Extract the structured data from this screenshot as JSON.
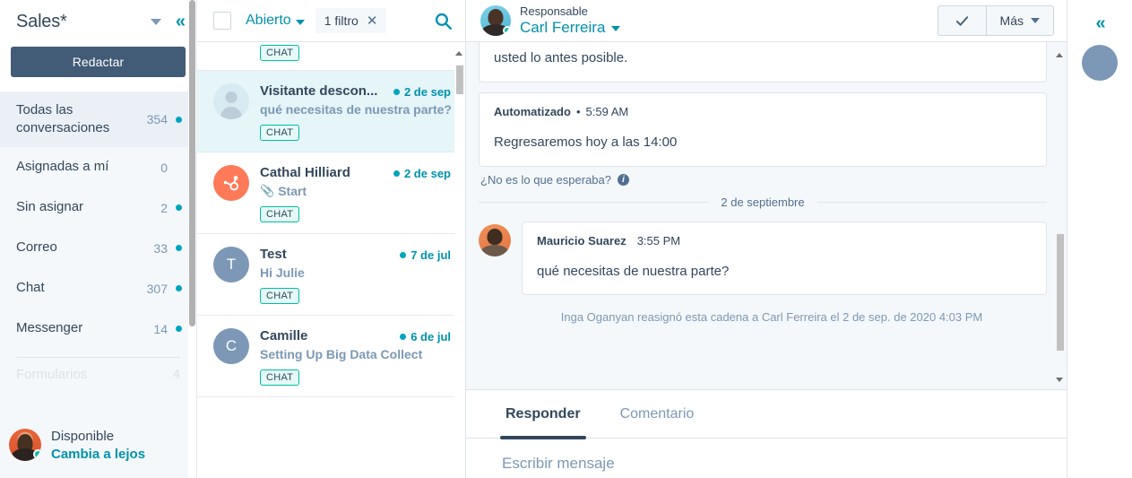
{
  "sidebar": {
    "title": "Sales*",
    "compose_label": "Redactar",
    "items": [
      {
        "label": "Todas las conversaciones",
        "count": "354",
        "dot": true
      },
      {
        "label": "Asignadas a mí",
        "count": "0",
        "dot": false
      },
      {
        "label": "Sin asignar",
        "count": "2",
        "dot": true
      },
      {
        "label": "Correo",
        "count": "33",
        "dot": true
      },
      {
        "label": "Chat",
        "count": "307",
        "dot": true
      },
      {
        "label": "Messenger",
        "count": "14",
        "dot": true
      }
    ],
    "status": {
      "state": "Disponible",
      "toggle_label": "Cambia a lejos"
    }
  },
  "conversation_list": {
    "filter_status": "Abierto",
    "filter_chip": "1 filtro",
    "filter_chip_close": "✕",
    "items": [
      {
        "name": "",
        "preview": "",
        "date": "",
        "badge": "CHAT",
        "avatar_kind": "generic",
        "initial": "",
        "selected": false,
        "partial": true
      },
      {
        "name": "Visitante descon...",
        "preview": "qué necesitas de nuestra parte?",
        "date": "2 de sep",
        "badge": "CHAT",
        "avatar_kind": "generic",
        "initial": "",
        "selected": true,
        "partial": false
      },
      {
        "name": "Cathal Hilliard",
        "preview": "Start",
        "attachment": true,
        "date": "2 de sep",
        "badge": "CHAT",
        "avatar_kind": "hubspot",
        "initial": "",
        "selected": false,
        "partial": false
      },
      {
        "name": "Test",
        "preview": "Hi Julie",
        "date": "7 de jul",
        "badge": "CHAT",
        "avatar_kind": "initial",
        "initial": "T",
        "selected": false,
        "partial": false
      },
      {
        "name": "Camille",
        "preview": "Setting Up Big Data Collect",
        "date": "6 de jul",
        "badge": "CHAT",
        "avatar_kind": "initial",
        "initial": "C",
        "selected": false,
        "partial": false
      }
    ]
  },
  "panel": {
    "assignee_role": "Responsable",
    "assignee_name": "Carl Ferreira",
    "close_button": "✓",
    "more_label": "Más",
    "messages": {
      "cut_bubble_text": "usted lo antes posible.",
      "auto_author": "Automatizado",
      "auto_separator": "•",
      "auto_time": "5:59 AM",
      "auto_text": "Regresaremos hoy a las 14:00",
      "hint": "¿No es lo que esperaba?",
      "date_divider": "2 de septiembre",
      "user_author": "Mauricio Suarez",
      "user_time": "3:55 PM",
      "user_text": "qué necesitas de nuestra parte?",
      "system_note": "Inga Oganyan reasignó esta cadena a Carl Ferreira el 2 de sep. de 2020 4:03 PM"
    },
    "composer": {
      "tab_reply": "Responder",
      "tab_comment": "Comentario",
      "placeholder": "Escribir mensaje"
    }
  },
  "colors": {
    "accent_teal": "#0091ae",
    "brand_navy": "#425b76",
    "badge_green": "#00bda5",
    "hubspot_orange": "#ff7a59",
    "selected_row": "#e5f5f8"
  }
}
